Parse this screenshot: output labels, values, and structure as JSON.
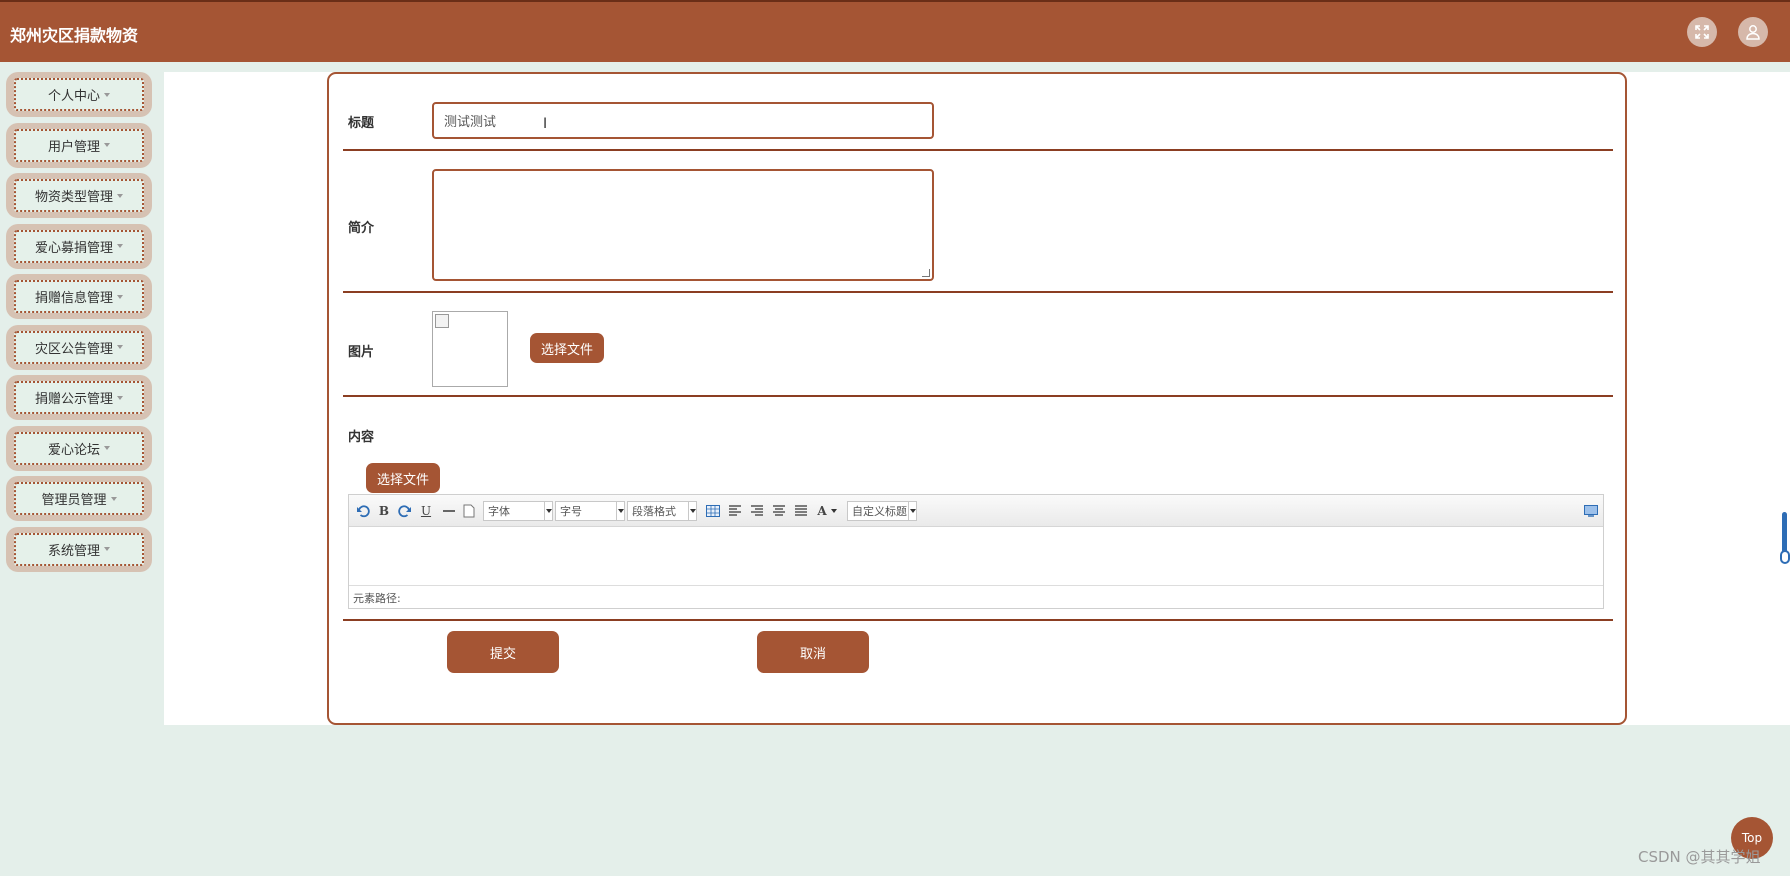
{
  "header": {
    "title": "郑州灾区捐款物资",
    "fullscreen_icon": "fullscreen-icon",
    "user_icon": "user-icon"
  },
  "sidebar": {
    "items": [
      {
        "label": "个人中心"
      },
      {
        "label": "用户管理"
      },
      {
        "label": "物资类型管理"
      },
      {
        "label": "爱心募捐管理"
      },
      {
        "label": "捐赠信息管理"
      },
      {
        "label": "灾区公告管理"
      },
      {
        "label": "捐赠公示管理"
      },
      {
        "label": "爱心论坛"
      },
      {
        "label": "管理员管理"
      },
      {
        "label": "系统管理"
      }
    ]
  },
  "form": {
    "title_label": "标题",
    "title_value": "测试测试",
    "intro_label": "简介",
    "intro_value": "",
    "image_label": "图片",
    "image_button": "选择文件",
    "content_label": "内容",
    "content_button": "选择文件",
    "editor": {
      "font_select": "字体",
      "size_select": "字号",
      "format_select": "段落格式",
      "custom_heading_select": "自定义标题",
      "bold_label": "B",
      "underline_label": "U",
      "font_color_label": "A",
      "element_path": "元素路径:"
    },
    "submit_button": "提交",
    "cancel_button": "取消"
  },
  "colors": {
    "brand": "#a55534",
    "background": "#e4efea",
    "sidebar_item_bg": "#d6c2b3"
  },
  "top_button": "Top",
  "watermark": "CSDN @其其学姐"
}
